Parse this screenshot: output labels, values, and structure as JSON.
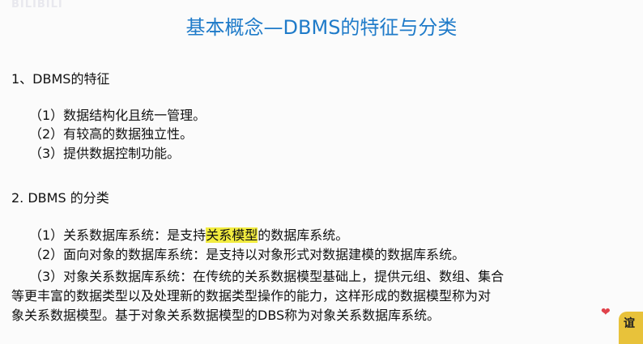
{
  "watermark": "BILIBILI",
  "title": "基本概念—DBMS的特征与分类",
  "section1": {
    "heading": "1、DBMS的特征",
    "items": [
      "（1）数据结构化且统一管理。",
      "（2）有较高的数据独立性。",
      "（3）提供数据控制功能。"
    ]
  },
  "section2": {
    "heading": "2. DBMS 的分类",
    "item1": {
      "prefix": "（1）关系数据库系统：是支持",
      "highlight": "关系模型",
      "suffix": "的数据库系统。"
    },
    "item2": "（2）面向对象的数据库系统：是支持以对象形式对数据建模的数据库系统。",
    "item3": {
      "line1": "（3）对象关系数据库系统：在传统的关系数据模型基础上，提供元组、数组、集合",
      "line2": "等更丰富的数据类型以及处理新的数据类型操作的能力，这样形成的数据模型称为对",
      "line3": "象关系数据模型。基于对象关系数据模型的DBS称为对象关系数据库系统。"
    }
  },
  "sticker": "谊",
  "colors": {
    "title": "#1f7bc9",
    "highlight": "#f2ec3f"
  }
}
